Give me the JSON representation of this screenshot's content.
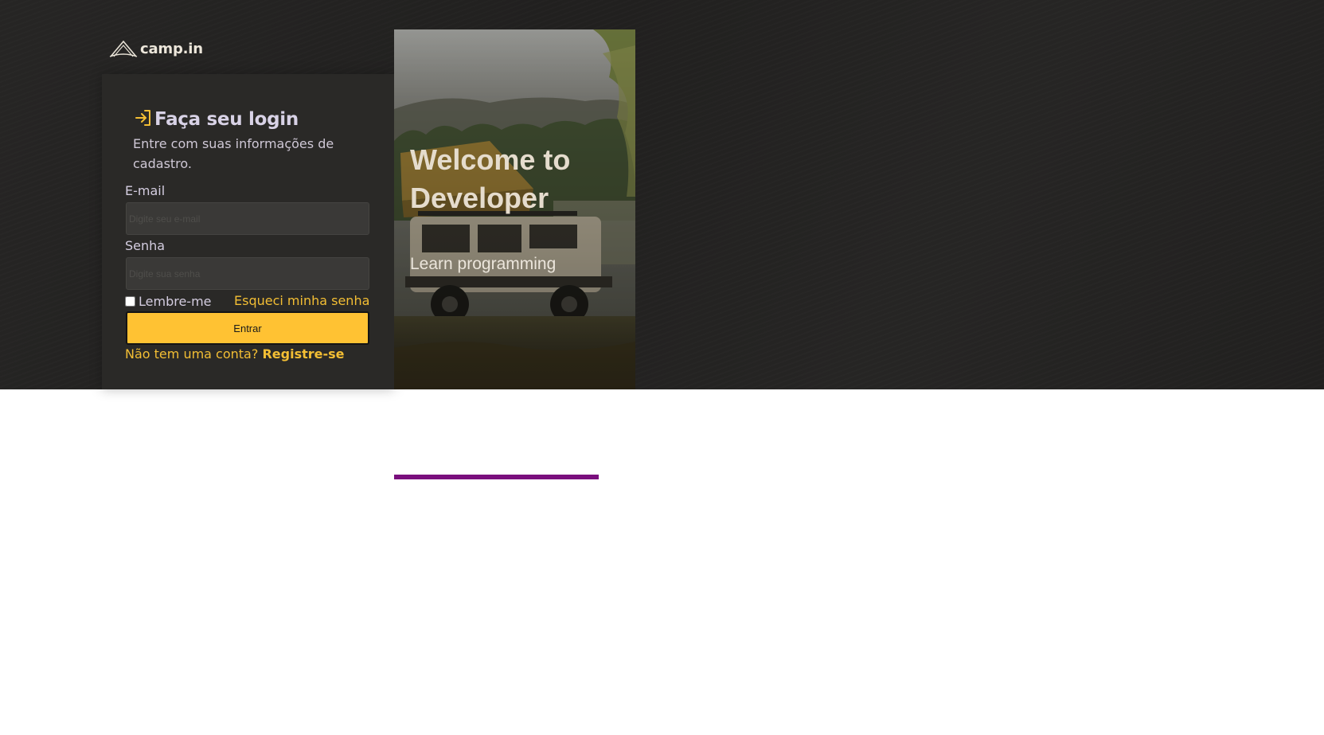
{
  "brand": {
    "name": "camp.in",
    "logo_icon": "tent-icon"
  },
  "login": {
    "title_icon": "login-arrow-icon",
    "title": "Faça seu login",
    "subtitle": "Entre com suas informações de cadastro.",
    "email_label": "E-mail",
    "email_placeholder": "Digite seu e-mail",
    "email_value": "",
    "password_label": "Senha",
    "password_placeholder": "Digite sua senha",
    "password_value": "",
    "remember_label": "Lembre-me",
    "remember_checked": false,
    "forgot_label": "Esqueci minha senha",
    "submit_label": "Entrar",
    "signup_question": "Não tem uma conta?",
    "signup_link": "Registre-se"
  },
  "hero": {
    "title": "Welcome to Developer",
    "subtitle": "Learn programming"
  },
  "colors": {
    "accent": "#ffc233",
    "background": "#222120",
    "card": "#2a2927",
    "divider": "#7a0f7d"
  }
}
